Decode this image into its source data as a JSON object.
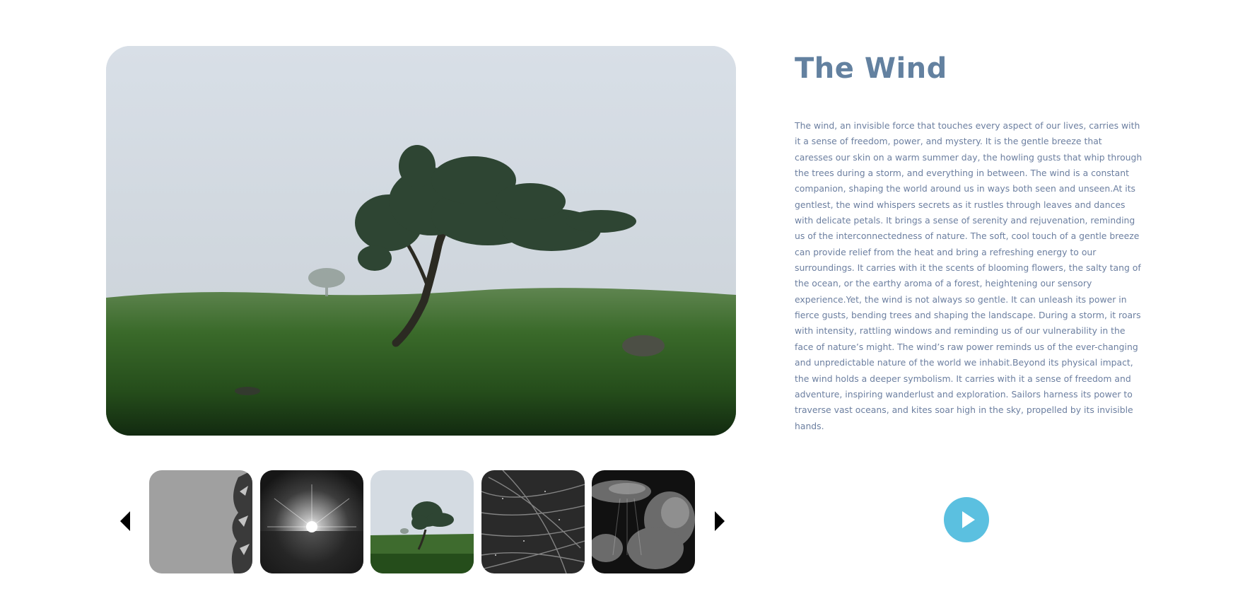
{
  "article": {
    "title": "The Wind",
    "body": "The wind, an invisible force that touches every aspect of our lives, carries with it a sense of freedom, power, and mystery. It is the gentle breeze that caresses our skin on a warm summer day, the howling gusts that whip through the trees during a storm, and everything in between. The wind is a constant companion, shaping the world around us in ways both seen and unseen.At its gentlest, the wind whispers secrets as it rustles through leaves and dances with delicate petals. It brings a sense of serenity and rejuvenation, reminding us of the interconnectedness of nature. The soft, cool touch of a gentle breeze can provide relief from the heat and bring a refreshing energy to our surroundings. It carries with it the scents of blooming flowers, the salty tang of the ocean, or the earthy aroma of a forest, heightening our sensory experience.Yet, the wind is not always so gentle. It can unleash its power in fierce gusts, bending trees and shaping the landscape. During a storm, it roars with intensity, rattling windows and reminding us of our vulnerability in the face of nature’s might. The wind’s raw power reminds us of the ever-changing and unpredictable nature of the world we inhabit.Beyond its physical impact, the wind holds a deeper symbolism. It carries with it a sense of freedom and adventure, inspiring wanderlust and exploration. Sailors harness its power to traverse vast oceans, and kites soar high in the sky, propelled by its invisible hands."
  },
  "gallery": {
    "main_image": "windswept-tree-in-foggy-meadow",
    "thumbnails": [
      "palm-leaves-gray-sky",
      "sunburst-over-sea",
      "windswept-tree-in-foggy-meadow",
      "wind-blown-grass",
      "dark-storm-clouds"
    ],
    "prev_icon": "arrow-left-icon",
    "next_icon": "arrow-right-icon"
  },
  "player": {
    "icon": "play-icon",
    "color": "#5bc0e0"
  },
  "colors": {
    "title": "#6381a0",
    "body": "#6c7fa0"
  }
}
